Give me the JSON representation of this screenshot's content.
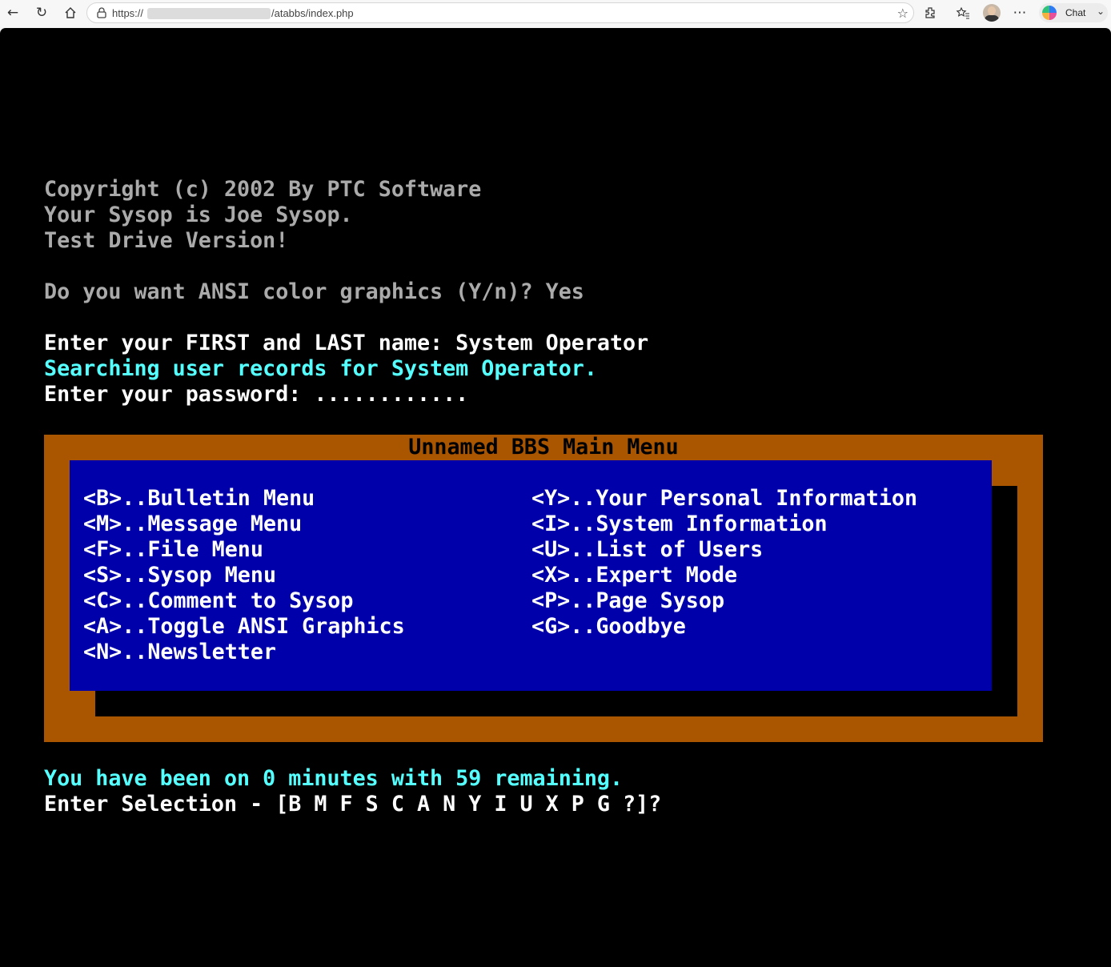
{
  "browser": {
    "url_scheme": "https://",
    "url_path": "/atabbs/index.php",
    "chat_label": "Chat"
  },
  "terminal": {
    "lines": [
      {
        "text": "Copyright (c) 2002 By PTC Software",
        "color": "#aaaaaa"
      },
      {
        "text": "Your Sysop is Joe Sysop.",
        "color": "#aaaaaa"
      },
      {
        "text": "Test Drive Version!",
        "color": "#aaaaaa"
      },
      {
        "text": "Do you want ANSI color graphics (Y/n)? Yes",
        "color": "#aaaaaa"
      },
      {
        "text": "Enter your FIRST and LAST name: System Operator",
        "color": "#ffffff"
      },
      {
        "text": "Searching user records for System Operator.",
        "color": "#55ffff"
      },
      {
        "text": "Enter your password: ............",
        "color": "#ffffff"
      }
    ],
    "menu": {
      "title": "Unnamed BBS Main Menu",
      "left_items": [
        "<B>..Bulletin Menu",
        "<M>..Message Menu",
        "<F>..File Menu",
        "<S>..Sysop Menu",
        "<C>..Comment to Sysop",
        "<A>..Toggle ANSI Graphics",
        "<N>..Newsletter"
      ],
      "right_items": [
        "<Y>..Your Personal Information",
        "<I>..System Information",
        "<U>..List of Users",
        "<X>..Expert Mode",
        "<P>..Page Sysop",
        "<G>..Goodbye"
      ],
      "colors": {
        "frame": "#aa5500",
        "panel": "#0000aa",
        "text": "#ffffff"
      }
    },
    "time_status": "You have been on 0 minutes with 59 remaining.",
    "prompt": "Enter Selection - [B M F S C A N Y I U X P G ?]?"
  }
}
